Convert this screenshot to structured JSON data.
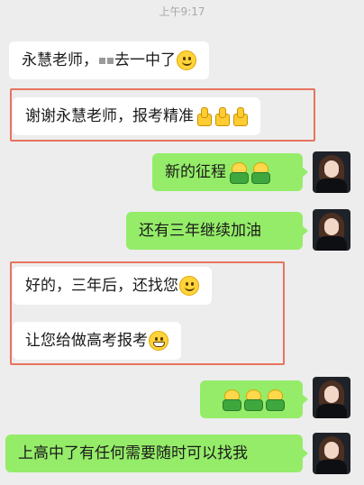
{
  "timestamp": "上午9:17",
  "messages": [
    {
      "side": "left",
      "text": "永慧老师，",
      "text_after": "去一中了",
      "emoji": "smile-emoji"
    },
    {
      "side": "left",
      "text": "谢谢永慧老师，报考精准",
      "emoji": "thumbs-up-emoji"
    },
    {
      "side": "right",
      "text": "新的征程",
      "emoji": "bao-emoji"
    },
    {
      "side": "right",
      "text": "还有三年继续加油"
    },
    {
      "side": "left",
      "text": "好的，三年后，还找您",
      "emoji": "smile-emoji"
    },
    {
      "side": "left",
      "text": "让您给做高考报考",
      "emoji": "grin-emoji"
    },
    {
      "side": "right",
      "text": "",
      "emoji": "bao-emoji"
    },
    {
      "side": "right",
      "text": "上高中了有任何需要随时可以找我"
    }
  ],
  "colors": {
    "background": "#ededed",
    "left_bubble": "#ffffff",
    "right_bubble": "#95ec69",
    "highlight_box": "#e8735f"
  }
}
